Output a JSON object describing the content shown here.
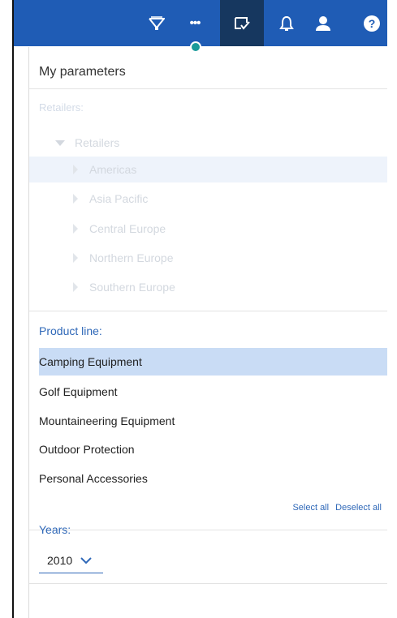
{
  "colors": {
    "topbar": "#1f5cb5",
    "topbar_active": "#16375f",
    "accent": "#2f68b8",
    "selected_row": "#c9dcf5",
    "indicator": "#1a9a9a"
  },
  "toolbar": {
    "icons": [
      "filter-icon",
      "more-icon",
      "checklist-icon",
      "bell-icon",
      "user-icon",
      "help-icon"
    ],
    "more_glyph": "•••",
    "help_glyph": "?"
  },
  "panel": {
    "title": "My parameters",
    "retailers": {
      "label": "Retailers:",
      "root": "Retailers",
      "items": [
        "Americas",
        "Asia Pacific",
        "Central Europe",
        "Northern Europe",
        "Southern Europe"
      ],
      "selected": "Americas"
    },
    "product_line": {
      "label": "Product line:",
      "items": [
        "Camping Equipment",
        "Golf Equipment",
        "Mountaineering Equipment",
        "Outdoor Protection",
        "Personal Accessories"
      ],
      "selected": "Camping Equipment",
      "select_all": "Select all",
      "deselect_all": "Deselect all"
    },
    "years": {
      "label": "Years:",
      "value": "2010"
    }
  }
}
